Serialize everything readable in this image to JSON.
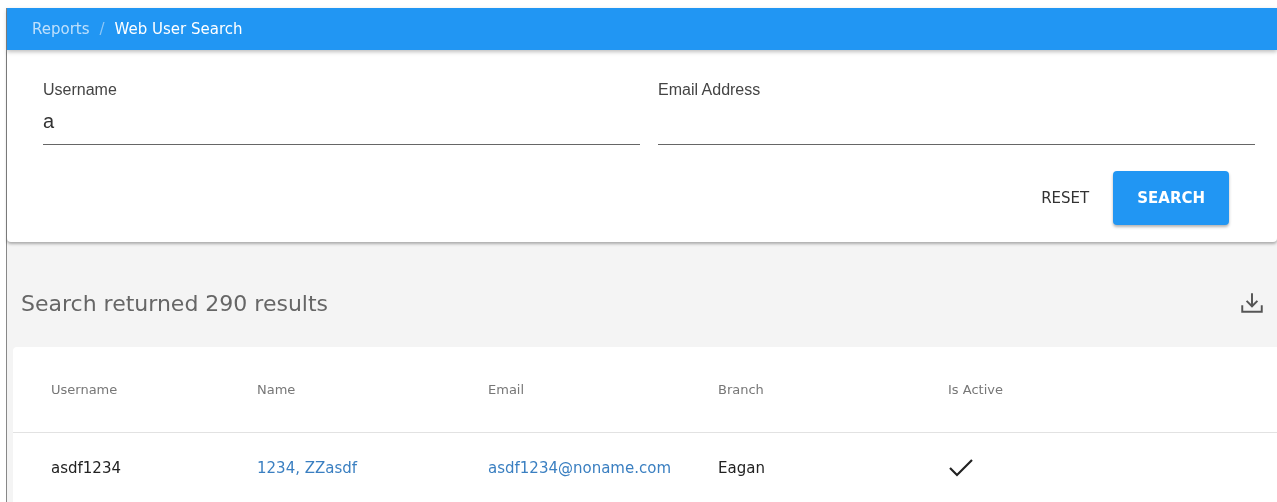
{
  "breadcrumb": {
    "items": [
      "Reports",
      "Web User Search"
    ],
    "separator": "/"
  },
  "search_form": {
    "fields": [
      {
        "label": "Username",
        "value": "a"
      },
      {
        "label": "Email Address"
      }
    ],
    "buttons": [
      {
        "label": "RESET",
        "kind": "text"
      },
      {
        "label": "SEARCH",
        "kind": "primary"
      }
    ]
  },
  "results": {
    "summary": "Search returned 290 results",
    "table": {
      "columns": [
        {
          "label": "Username",
          "kind": "text"
        },
        {
          "label": "Name",
          "kind": "link"
        },
        {
          "label": "Email",
          "kind": "link"
        },
        {
          "label": "Branch",
          "kind": "text"
        },
        {
          "label": "Is Active",
          "kind": "check"
        }
      ],
      "rows": [
        {
          "cells": [
            "asdf1234",
            "1234, ZZasdf",
            "asdf1234@noname.com",
            "Eagan"
          ],
          "is_active": true
        }
      ]
    }
  }
}
